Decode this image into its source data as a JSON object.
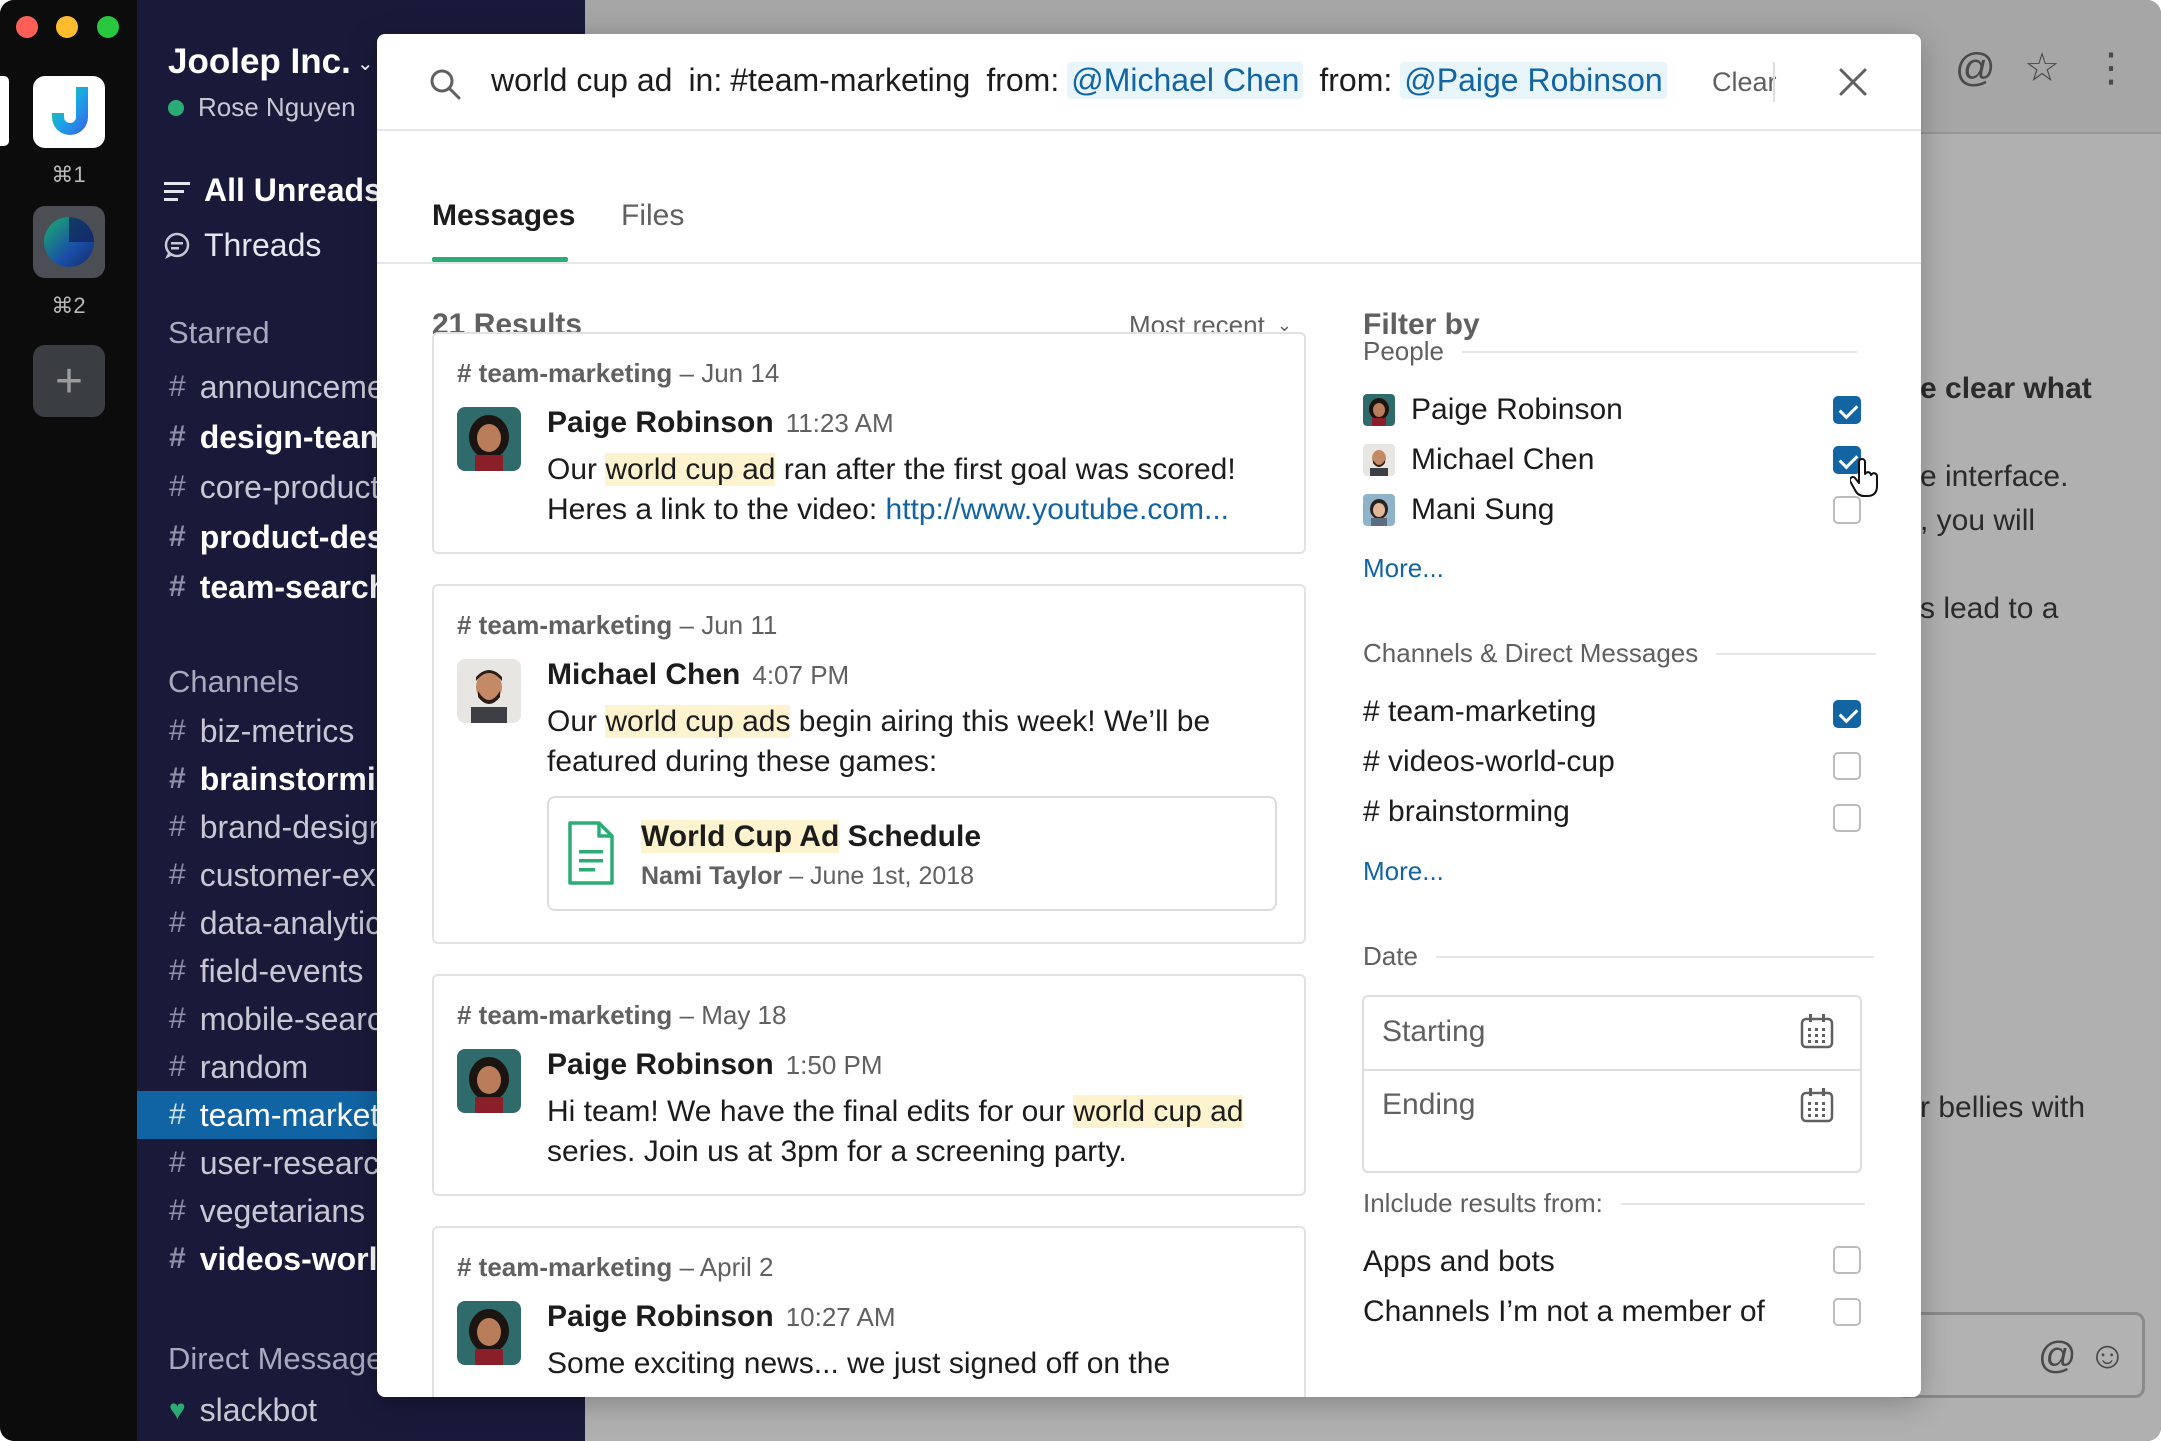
{
  "workspaces": {
    "shortcut_1": "⌘1",
    "shortcut_2": "⌘2",
    "add_icon": "plus-icon"
  },
  "sidebar": {
    "team_name": "Joolep Inc.",
    "user_name": "Rose Nguyen",
    "all_unreads": "All Unreads",
    "threads": "Threads",
    "starred_label": "Starred",
    "starred": [
      {
        "name": "announceme",
        "bold": false
      },
      {
        "name": "design-team",
        "bold": true
      },
      {
        "name": "core-product",
        "bold": false
      },
      {
        "name": "product-des",
        "bold": true
      },
      {
        "name": "team-search",
        "bold": true
      }
    ],
    "channels_label": "Channels",
    "channels": [
      {
        "name": "biz-metrics",
        "bold": false
      },
      {
        "name": "brainstormin",
        "bold": true
      },
      {
        "name": "brand-design",
        "bold": false
      },
      {
        "name": "customer-ex",
        "bold": false
      },
      {
        "name": "data-analytic",
        "bold": false
      },
      {
        "name": "field-events",
        "bold": false
      },
      {
        "name": "mobile-searc",
        "bold": false
      },
      {
        "name": "random",
        "bold": false
      },
      {
        "name": "team-market",
        "bold": false,
        "selected": true
      },
      {
        "name": "user-researc",
        "bold": false
      },
      {
        "name": "vegetarians",
        "bold": false
      },
      {
        "name": "videos-world",
        "bold": true
      }
    ],
    "dm_label": "Direct Message",
    "dm_slackbot": "slackbot"
  },
  "background": {
    "line1": "e clear what",
    "line2": "e interface.",
    "line3": ", you will",
    "line4": "s lead to a",
    "line5": "r bellies with"
  },
  "search": {
    "query_text": "world cup ad",
    "in_label": "in:",
    "in_channel": "#team-marketing",
    "from_label_1": "from:",
    "from_user_1": "@Michael Chen",
    "from_label_2": "from:",
    "from_user_2": "@Paige Robinson",
    "clear_label": "Clear"
  },
  "tabs": {
    "messages": "Messages",
    "files": "Files"
  },
  "results": {
    "count": "21 Results",
    "sort": "Most recent",
    "items": [
      {
        "channel": "# team-marketing",
        "date": " – Jun 14",
        "author": "Paige Robinson",
        "time": "11:23 AM",
        "pre": "Our ",
        "hl": "world cup ad",
        "post": " ran after the first goal was scored! Heres a link to the video: ",
        "link": "http://www.youtube.com..."
      },
      {
        "channel": "# team-marketing",
        "date": " – Jun 11",
        "author": "Michael Chen",
        "time": "4:07 PM",
        "pre": "Our ",
        "hl": "world cup ads",
        "post": " begin airing this week! We’ll be featured during these games:",
        "file_title_hl": "World Cup Ad",
        "file_title_rest": " Schedule",
        "file_owner": "Nami Taylor",
        "file_date": " – June 1st, 2018"
      },
      {
        "channel": "# team-marketing",
        "date": " – May 18",
        "author": "Paige Robinson",
        "time": "1:50 PM",
        "pre": "Hi team! We have the final edits for our ",
        "hl": "world cup ad",
        "post": " series. Join us at 3pm for a screening party."
      },
      {
        "channel": "# team-marketing",
        "date": " – April 2",
        "author": "Paige Robinson",
        "time": "10:27 AM",
        "pre": "Some exciting news... we just signed off on the",
        "hl": "",
        "post": ""
      }
    ]
  },
  "filters": {
    "title": "Filter by",
    "people_label": "People",
    "people": [
      {
        "name": "Paige Robinson",
        "checked": true
      },
      {
        "name": "Michael Chen",
        "checked": true
      },
      {
        "name": "Mani Sung",
        "checked": false
      }
    ],
    "people_more": "More...",
    "channels_label": "Channels & Direct Messages",
    "channels": [
      {
        "name": "# team-marketing",
        "checked": true
      },
      {
        "name": "# videos-world-cup",
        "checked": false
      },
      {
        "name": "# brainstorming",
        "checked": false
      }
    ],
    "channels_more": "More...",
    "date_label": "Date",
    "date_start_placeholder": "Starting",
    "date_end_placeholder": "Ending",
    "include_label": "Inlclude results from:",
    "include": [
      {
        "name": "Apps and bots",
        "checked": false
      },
      {
        "name": "Channels I’m not a member of",
        "checked": false
      }
    ]
  },
  "colors": {
    "sidebar_bg": "#19193a",
    "selected_channel": "#1164a3",
    "accent_green": "#2bac76",
    "link_blue": "#1264a3",
    "highlight": "#fdf3cf"
  }
}
